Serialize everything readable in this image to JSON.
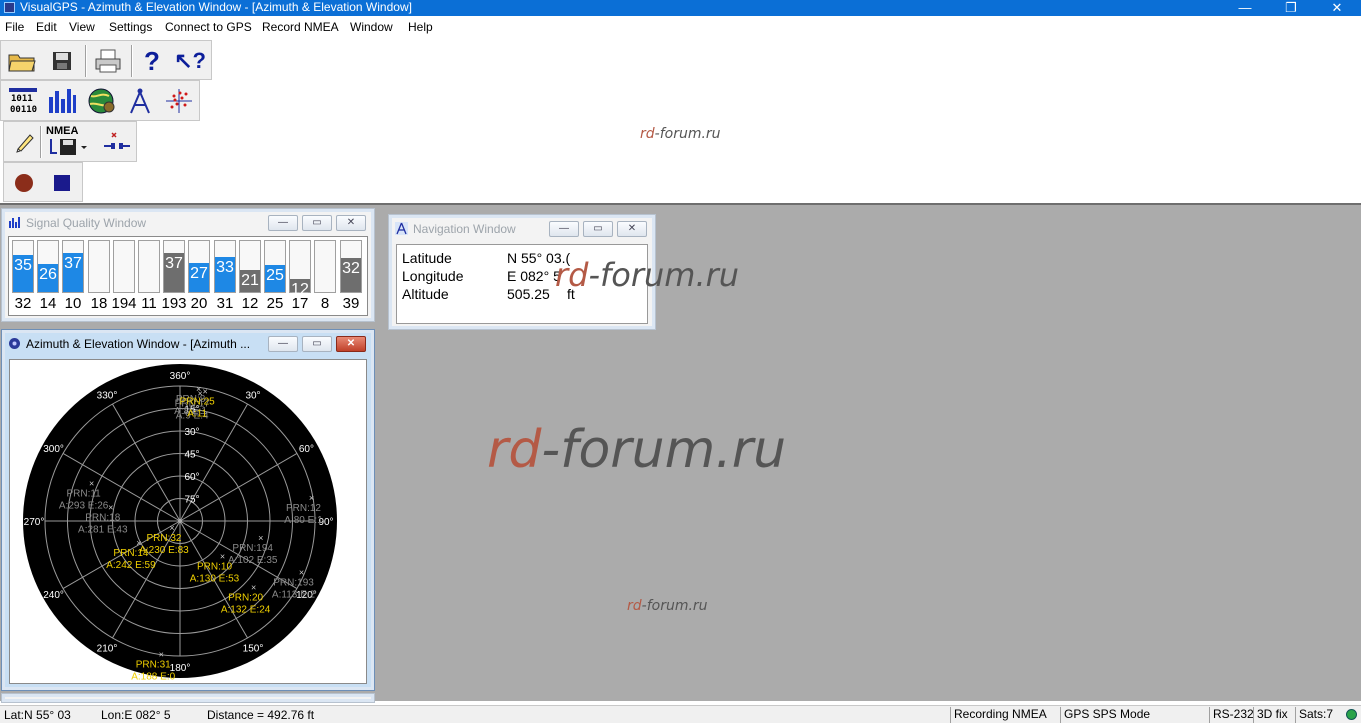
{
  "titlebar": {
    "title": "VisualGPS - Azimuth & Elevation Window - [Azimuth & Elevation Window]",
    "minimize_glyph": "—",
    "maximize_glyph": "❐",
    "close_glyph": "✕"
  },
  "menubar": {
    "items": [
      "File",
      "Edit",
      "View",
      "Settings",
      "Connect to GPS",
      "Record NMEA",
      "Window",
      "Help"
    ]
  },
  "toolbars": {
    "row1": [
      "open-folder-icon",
      "save-icon",
      "print-icon",
      "help-icon",
      "context-help-icon"
    ],
    "row2": [
      "binary-data-icon",
      "bar-chart-icon",
      "globe-icon",
      "compass-icon",
      "scatter-plot-icon"
    ],
    "row3": [
      "pen-icon",
      "nmea-record-icon",
      "disconnect-icon"
    ],
    "nmea_label": "NMEA",
    "row4": [
      "record-icon",
      "stop-icon"
    ],
    "colors": {
      "record": "#8b2d1a",
      "stop": "#1a1a8c"
    }
  },
  "signal_window": {
    "title": "Signal Quality Window",
    "bars": [
      {
        "prn": "32",
        "snr": "35",
        "level": 35,
        "color": "#1e88e5"
      },
      {
        "prn": "14",
        "snr": "26",
        "level": 26,
        "color": "#1e88e5"
      },
      {
        "prn": "10",
        "snr": "37",
        "level": 37,
        "color": "#1e88e5"
      },
      {
        "prn": "18",
        "snr": "",
        "level": 0,
        "color": "#1e88e5"
      },
      {
        "prn": "194",
        "snr": "",
        "level": 0,
        "color": "#1e88e5"
      },
      {
        "prn": "11",
        "snr": "",
        "level": 0,
        "color": "#1e88e5"
      },
      {
        "prn": "193",
        "snr": "37",
        "level": 37,
        "color": "#6e6e6e"
      },
      {
        "prn": "20",
        "snr": "27",
        "level": 27,
        "color": "#1e88e5"
      },
      {
        "prn": "31",
        "snr": "33",
        "level": 33,
        "color": "#1e88e5"
      },
      {
        "prn": "12",
        "snr": "21",
        "level": 21,
        "color": "#6e6e6e"
      },
      {
        "prn": "25",
        "snr": "25",
        "level": 25,
        "color": "#1e88e5"
      },
      {
        "prn": "17",
        "snr": "12",
        "level": 12,
        "color": "#6e6e6e"
      },
      {
        "prn": "8",
        "snr": "",
        "level": 0,
        "color": "#6e6e6e"
      },
      {
        "prn": "39",
        "snr": "32",
        "level": 32,
        "color": "#6e6e6e"
      }
    ]
  },
  "nav_window": {
    "title": "Navigation Window",
    "rows": [
      {
        "label": "Latitude",
        "value": "N 55° 03.("
      },
      {
        "label": "Longitude",
        "value": "E 082° 5"
      },
      {
        "label": "Altitude",
        "value": "505.25",
        "unit": "ft"
      }
    ]
  },
  "azel_window": {
    "title": "Azimuth & Elevation Window - [Azimuth ...",
    "azimuth_labels": [
      "360°",
      "30°",
      "60°",
      "90°",
      "120°",
      "150°",
      "180°",
      "210°",
      "240°",
      "270°",
      "300°",
      "330°"
    ],
    "elevation_labels": [
      "15°",
      "30°",
      "45°",
      "60°",
      "75°"
    ],
    "satellites": [
      {
        "prn": "PRN:17",
        "azel": "A:9 E:4",
        "used": false
      },
      {
        "prn": "PRN:11",
        "azel": "A:293 E:26",
        "used": false
      },
      {
        "prn": "PRN:18",
        "azel": "A:281 E:43",
        "used": false
      },
      {
        "prn": "PRN:12",
        "azel": "A:80 E:1",
        "used": false
      },
      {
        "prn": "PRN:194",
        "azel": "A:102 E:35",
        "used": false
      },
      {
        "prn": "PRN:193",
        "azel": "A:113 E:2",
        "used": false
      },
      {
        "prn": "PRN:8",
        "azel": "A:8 E:1",
        "used": false
      },
      {
        "prn": "PRN:32",
        "azel": "A:230 E:83",
        "used": true
      },
      {
        "prn": "PRN:14",
        "azel": "A:242 E:59",
        "used": true
      },
      {
        "prn": "PRN:10",
        "azel": "A:130 E:53",
        "used": true
      },
      {
        "prn": "PRN:20",
        "azel": "A:132 E:24",
        "used": true
      },
      {
        "prn": "PRN:25",
        "azel": "A:11",
        "used": true
      },
      {
        "prn": "PRN:31",
        "azel": "A:188 E:0",
        "used": true
      }
    ],
    "colors": {
      "used": "#f0d000",
      "unused": "#8a8a8a",
      "grid": "#9a9a9a"
    }
  },
  "statusbar": {
    "lat": "Lat:N 55° 03",
    "lon": "Lon:E 082° 5",
    "distance": "Distance = 492.76 ft",
    "recording": "Recording NMEA",
    "mode": "GPS SPS Mode",
    "port": "RS-232",
    "fix": "3D fix",
    "sats": "Sats:7"
  },
  "watermark": {
    "part_a": "rd",
    "part_b": "-forum.ru"
  }
}
